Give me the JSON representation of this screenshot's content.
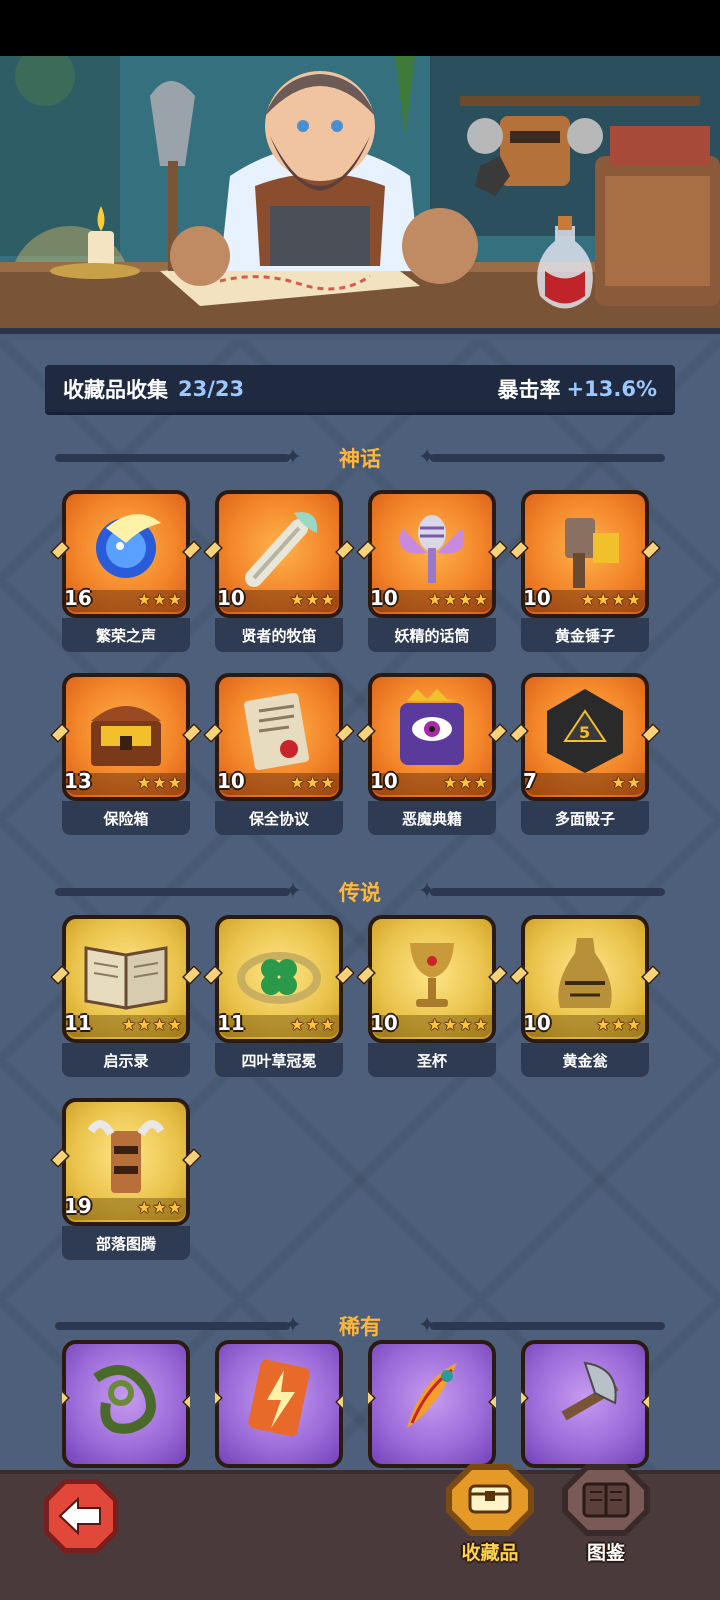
{
  "summary": {
    "label": "收藏品收集",
    "count": "23/23",
    "crit_label": "暴击率",
    "crit_value": "+13.6%"
  },
  "sections": [
    {
      "title": "神话",
      "rarity": "mythic",
      "items": [
        {
          "name": "繁荣之声",
          "level": "16",
          "stars": 3,
          "icon": "spirit-orb-icon"
        },
        {
          "name": "贤者的牧笛",
          "level": "10",
          "stars": 3,
          "icon": "flute-icon"
        },
        {
          "name": "妖精的话筒",
          "level": "10",
          "stars": 4,
          "icon": "fairy-microphone-icon"
        },
        {
          "name": "黄金锤子",
          "level": "10",
          "stars": 4,
          "icon": "golden-hammer-icon"
        },
        {
          "name": "保险箱",
          "level": "13",
          "stars": 3,
          "icon": "treasure-chest-icon"
        },
        {
          "name": "保全协议",
          "level": "10",
          "stars": 3,
          "icon": "scroll-contract-icon"
        },
        {
          "name": "恶魔典籍",
          "level": "10",
          "stars": 3,
          "icon": "demon-book-icon"
        },
        {
          "name": "多面骰子",
          "level": "7",
          "stars": 2,
          "icon": "dice-icon"
        }
      ]
    },
    {
      "title": "传说",
      "rarity": "legend",
      "items": [
        {
          "name": "启示录",
          "level": "11",
          "stars": 4,
          "icon": "open-book-icon"
        },
        {
          "name": "四叶草冠冕",
          "level": "11",
          "stars": 3,
          "icon": "clover-crown-icon"
        },
        {
          "name": "圣杯",
          "level": "10",
          "stars": 4,
          "icon": "grail-icon"
        },
        {
          "name": "黄金瓮",
          "level": "10",
          "stars": 3,
          "icon": "golden-urn-icon"
        },
        {
          "name": "部落图腾",
          "level": "19",
          "stars": 3,
          "icon": "tribal-totem-icon"
        }
      ]
    },
    {
      "title": "稀有",
      "rarity": "rare",
      "items": [
        {
          "name": "",
          "icon": "thorn-vine-icon"
        },
        {
          "name": "",
          "icon": "lightning-card-icon"
        },
        {
          "name": "",
          "icon": "phoenix-feather-icon"
        },
        {
          "name": "",
          "icon": "axe-icon"
        }
      ]
    }
  ],
  "nav": {
    "collection_label": "收藏品",
    "codex_label": "图鉴"
  },
  "colors": {
    "mythic": "#f3862a",
    "legend": "#e9c24a",
    "rare": "#9a6ad8",
    "accent": "#ffb63a",
    "crit": "#9cc8ff"
  }
}
